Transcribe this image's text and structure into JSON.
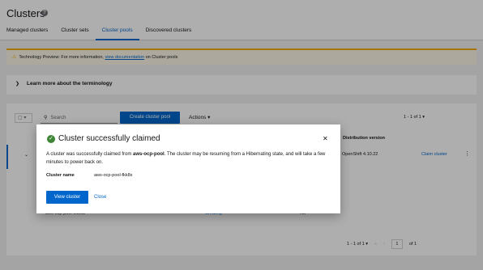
{
  "header": {
    "title": "Clusters",
    "help_icon": "help-icon",
    "tabs": [
      {
        "label": "Managed clusters",
        "active": false
      },
      {
        "label": "Cluster sets",
        "active": false
      },
      {
        "label": "Cluster pools",
        "active": true
      },
      {
        "label": "Discovered clusters",
        "active": false
      }
    ]
  },
  "alert": {
    "prefix": "Technology Preview: For more information, ",
    "link": "view documentation",
    "suffix": " on Cluster pools"
  },
  "expandable": {
    "label": "Learn more about the terminology"
  },
  "toolbar": {
    "search_placeholder": "Search",
    "create_label": "Create cluster pool",
    "actions_label": "Actions",
    "pagination_top": "1 - 1 of 1"
  },
  "table": {
    "column_distribution": "Distribution version",
    "row1": {
      "version": "OpenShift 4.10.22",
      "claim_label": "Claim cluster"
    },
    "row2": {
      "name": "aws-ocp-pool-9ss68",
      "status": "Creating",
      "hibernating": "No"
    }
  },
  "pagination_bottom": {
    "range": "1 - 1 of 1",
    "page": "1",
    "of": "of 1"
  },
  "modal": {
    "title": "Cluster successfully claimed",
    "body_prefix": "A cluster was successfully claimed from ",
    "pool_name": "aws-ocp-pool",
    "body_suffix": ". The cluster may be resuming from a Hibernating state, and will take a few minutes to power back on.",
    "field_label": "Cluster name",
    "field_value": "aws-ocp-pool-fkk8s",
    "view_button": "View cluster",
    "close_button": "Close"
  }
}
